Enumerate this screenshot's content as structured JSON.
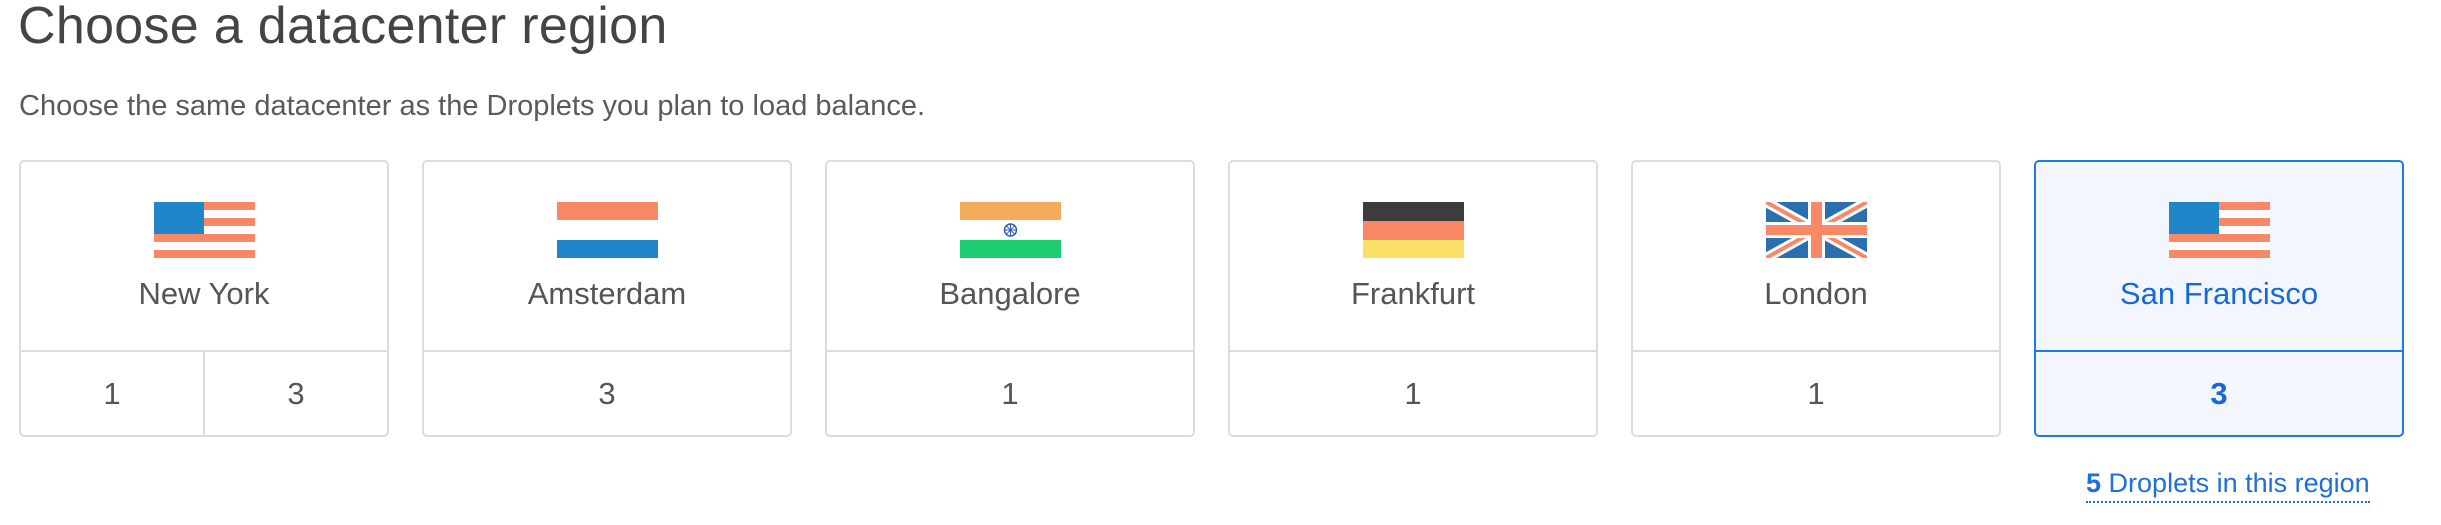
{
  "title": "Choose a datacenter region",
  "subtitle": "Choose the same datacenter as the Droplets you plan to load balance.",
  "colors": {
    "accent": "#1e7be6",
    "selected_bg": "#f3f7fd",
    "border": "#dcdcdc",
    "flag_red": "#f88866",
    "flag_blue": "#2185c9"
  },
  "regions": [
    {
      "name": "New York",
      "flag_icon": "us-flag-icon",
      "counts": [
        "1",
        "3"
      ],
      "selected": false
    },
    {
      "name": "Amsterdam",
      "flag_icon": "netherlands-flag-icon",
      "counts": [
        "3"
      ],
      "selected": false
    },
    {
      "name": "Bangalore",
      "flag_icon": "india-flag-icon",
      "counts": [
        "1"
      ],
      "selected": false
    },
    {
      "name": "Frankfurt",
      "flag_icon": "germany-flag-icon",
      "counts": [
        "1"
      ],
      "selected": false
    },
    {
      "name": "London",
      "flag_icon": "uk-flag-icon",
      "counts": [
        "1"
      ],
      "selected": false
    },
    {
      "name": "San Francisco",
      "flag_icon": "us-flag-icon",
      "counts": [
        "3"
      ],
      "selected": true
    }
  ],
  "droplets_summary": {
    "count": "5",
    "label": "Droplets in this region"
  }
}
